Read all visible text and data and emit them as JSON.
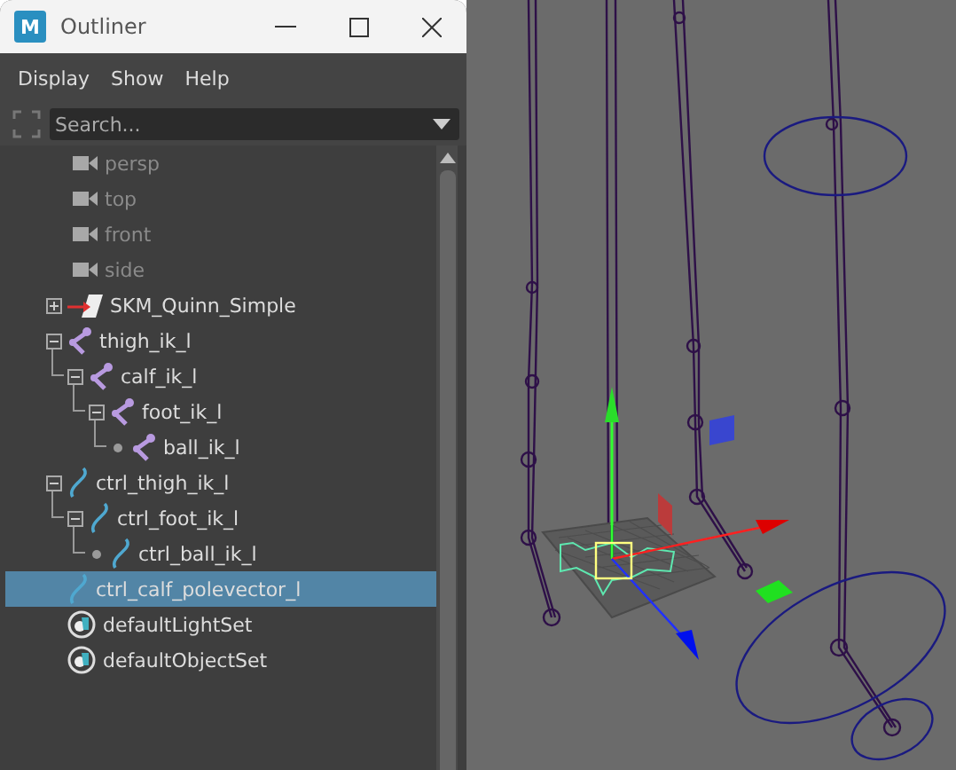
{
  "window": {
    "logo": "M",
    "title": "Outliner"
  },
  "menu": [
    "Display",
    "Show",
    "Help"
  ],
  "search": {
    "placeholder": "Search..."
  },
  "tree": [
    {
      "kind": "camera",
      "label": "persp",
      "hidden": true,
      "selected": false
    },
    {
      "kind": "camera",
      "label": "top",
      "hidden": true,
      "selected": false
    },
    {
      "kind": "camera",
      "label": "front",
      "hidden": true,
      "selected": false
    },
    {
      "kind": "camera",
      "label": "side",
      "hidden": true,
      "selected": false
    },
    {
      "kind": "mesh",
      "label": "SKM_Quinn_Simple",
      "hidden": false,
      "selected": false,
      "expanded": false
    },
    {
      "kind": "joint",
      "label": "thigh_ik_l",
      "hidden": false,
      "selected": false,
      "expanded": true,
      "children": [
        {
          "kind": "joint",
          "label": "calf_ik_l",
          "hidden": false,
          "selected": false,
          "expanded": true,
          "children": [
            {
              "kind": "joint",
              "label": "foot_ik_l",
              "hidden": false,
              "selected": false,
              "expanded": true,
              "children": [
                {
                  "kind": "joint",
                  "label": "ball_ik_l",
                  "hidden": false,
                  "selected": false
                }
              ]
            }
          ]
        }
      ]
    },
    {
      "kind": "curve",
      "label": "ctrl_thigh_ik_l",
      "hidden": false,
      "selected": false,
      "expanded": true,
      "children": [
        {
          "kind": "curve",
          "label": "ctrl_foot_ik_l",
          "hidden": false,
          "selected": false,
          "expanded": true,
          "children": [
            {
              "kind": "curve",
              "label": "ctrl_ball_ik_l",
              "hidden": false,
              "selected": false
            }
          ]
        }
      ]
    },
    {
      "kind": "curve",
      "label": "ctrl_calf_polevector_l",
      "hidden": false,
      "selected": true
    },
    {
      "kind": "set",
      "label": "defaultLightSet",
      "hidden": false,
      "selected": false
    },
    {
      "kind": "set",
      "label": "defaultObjectSet",
      "hidden": false,
      "selected": false
    }
  ]
}
